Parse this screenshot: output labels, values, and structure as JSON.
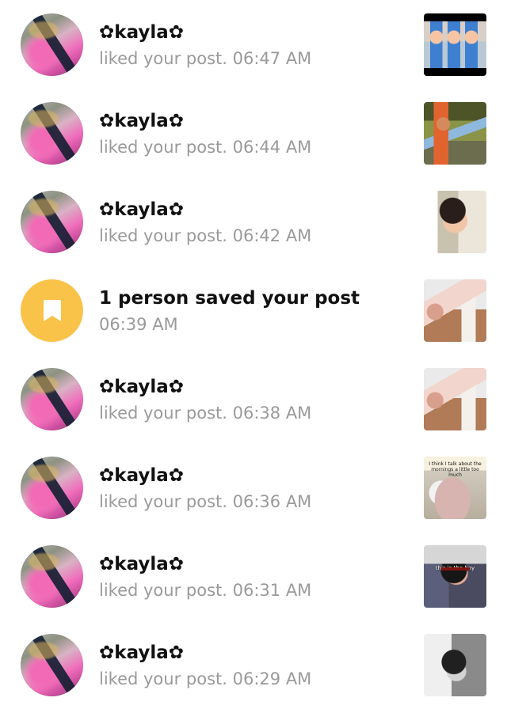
{
  "notifications": [
    {
      "type": "like",
      "username": "✿kayla✿",
      "action": "liked your post.",
      "time": "06:47 AM"
    },
    {
      "type": "like",
      "username": "✿kayla✿",
      "action": "liked your post.",
      "time": "06:44 AM"
    },
    {
      "type": "like",
      "username": "✿kayla✿",
      "action": "liked your post.",
      "time": "06:42 AM"
    },
    {
      "type": "save",
      "title": "1 person saved your post",
      "time": "06:39 AM"
    },
    {
      "type": "like",
      "username": "✿kayla✿",
      "action": "liked your post.",
      "time": "06:38 AM"
    },
    {
      "type": "like",
      "username": "✿kayla✿",
      "action": "liked your post.",
      "time": "06:36 AM",
      "thumbnail_caption": "I think I talk about the mornings a little too much"
    },
    {
      "type": "like",
      "username": "✿kayla✿",
      "action": "liked your post.",
      "time": "06:31 AM",
      "thumbnail_overlay": "this is the boy"
    },
    {
      "type": "like",
      "username": "✿kayla✿",
      "action": "liked your post.",
      "time": "06:29 AM"
    }
  ],
  "colors": {
    "background": "#ffffff",
    "primary_text": "#111111",
    "secondary_text": "#9a9a9a",
    "save_badge": "#f9c349"
  },
  "icons": {
    "save": "bookmark-icon"
  }
}
